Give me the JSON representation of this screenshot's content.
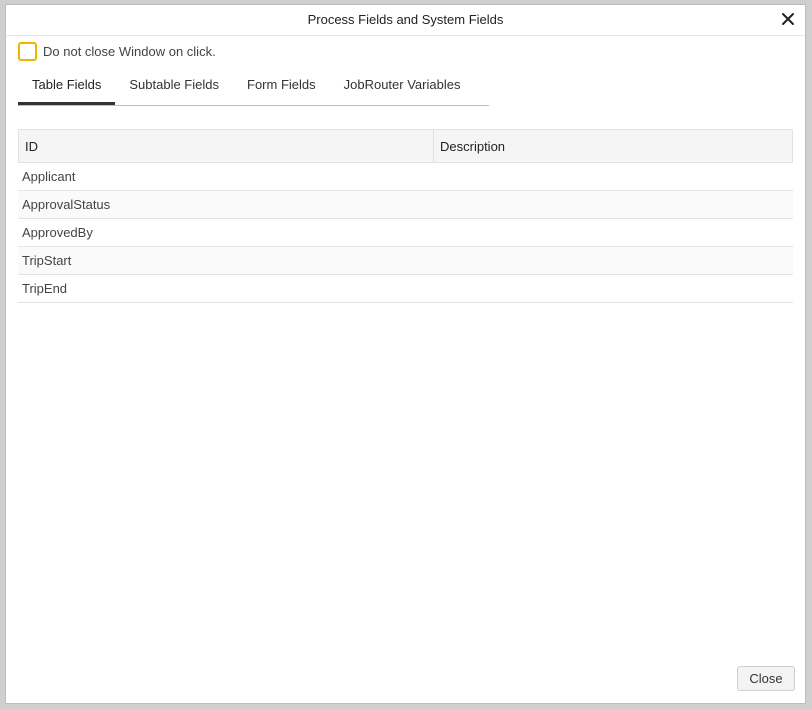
{
  "dialog": {
    "title": "Process Fields and System Fields",
    "keep_open_label": "Do not close Window on click.",
    "keep_open_checked": false,
    "close_label": "Close"
  },
  "tabs": [
    {
      "label": "Table Fields",
      "active": true
    },
    {
      "label": "Subtable Fields",
      "active": false
    },
    {
      "label": "Form Fields",
      "active": false
    },
    {
      "label": "JobRouter Variables",
      "active": false
    }
  ],
  "table": {
    "columns": [
      "ID",
      "Description"
    ],
    "rows": [
      {
        "id": "Applicant",
        "description": ""
      },
      {
        "id": "ApprovalStatus",
        "description": ""
      },
      {
        "id": "ApprovedBy",
        "description": ""
      },
      {
        "id": "TripStart",
        "description": ""
      },
      {
        "id": "TripEnd",
        "description": ""
      }
    ]
  },
  "colors": {
    "checkbox_border": "#f0b400",
    "active_tab_underline": "#333333"
  }
}
